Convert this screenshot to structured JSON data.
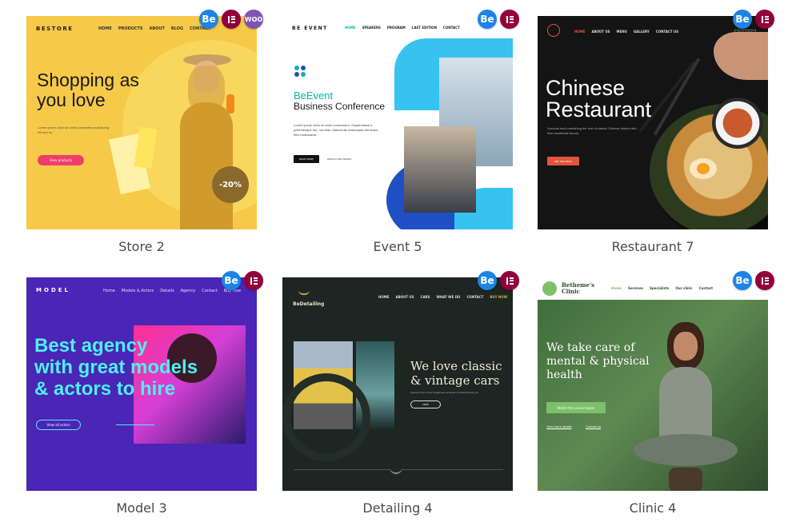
{
  "icons": {
    "be": "Be",
    "woo": "WOO"
  },
  "cards": [
    {
      "caption": "Store 2",
      "logo": "BESTORE",
      "nav": [
        "HOME",
        "PRODUCTS",
        "ABOUT",
        "BLOG",
        "CONTACT"
      ],
      "headline": "Shopping as you love",
      "body": "Lorem ipsum dolor sit amet consectetur adipiscing elit sed do",
      "cta": "View products",
      "discount": "-20%"
    },
    {
      "caption": "Event 5",
      "logo": "BE EVENT",
      "nav": [
        "HOME",
        "SPEAKERS",
        "PROGRAM",
        "LAST EDITION",
        "CONTACT"
      ],
      "headline1": "BeEvent",
      "headline2": "Business Conference",
      "body": "Lorem ipsum dolor sit amet consectetur. Suspendisse a pellentesque dui, non felis. Maecenas malesuada elit lectus felis malesuada.",
      "cta": "READ MORE",
      "cta2": "WATCH OUR PROMO"
    },
    {
      "caption": "Restaurant 7",
      "nav": [
        "HOME",
        "ABOUT US",
        "MENU",
        "GALLERY",
        "CONTACT US"
      ],
      "buy": "BUY NOW",
      "headline1": "Chinese",
      "headline2": "Restaurant",
      "body": "Unusual food combining the rest of classic Chinese dishes with their traditional flavour.",
      "cta": "SEE THE MENU"
    },
    {
      "caption": "Model 3",
      "logo": "MODEL",
      "nav": [
        "Home",
        "Models & Actors",
        "Details",
        "Agency",
        "Contact",
        "Buy now"
      ],
      "headline1": "Best agency",
      "headline2": "with great models",
      "headline3": "& actors to hire",
      "cta": "View all actors"
    },
    {
      "caption": "Detailing 4",
      "logo": "BeDetailing",
      "nav": [
        "HOME",
        "ABOUT US",
        "CARS",
        "WHAT WE DO",
        "CONTACT",
        "BUY NOW"
      ],
      "headline1": "We love classic",
      "headline2": "& vintage cars",
      "body": "Quisque lorem tortor fringilla sed vestibulum id eleifend justo vel",
      "cta": "VIEW"
    },
    {
      "caption": "Clinic 4",
      "logo1": "Betheme's",
      "logo2": "Clinic",
      "nav": [
        "Home",
        "Services",
        "Specialists",
        "Our clinic",
        "Contact"
      ],
      "headline1": "We take care of",
      "headline2": "mental & physical",
      "headline3": "health",
      "cta": "Watch the presentation",
      "link1": "View more details",
      "link2": "Contact us"
    }
  ],
  "colors": {
    "be_blue": "#1d83e8",
    "elementor": "#92003b",
    "woo": "#7f54b3"
  }
}
